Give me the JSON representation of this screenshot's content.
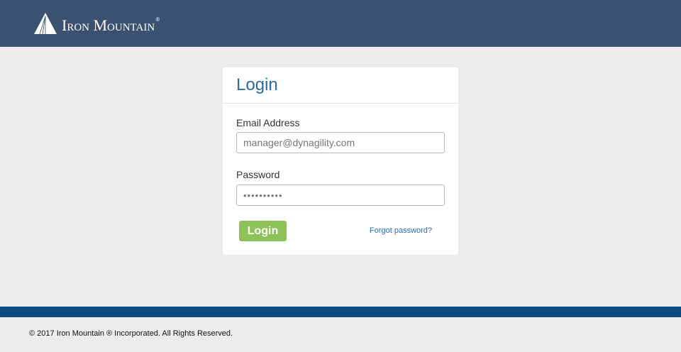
{
  "header": {
    "brand": "Iron Mountain",
    "logo_icon": "mountain-logo-icon",
    "colors": {
      "background": "#3a5170",
      "logo": "#ffffff"
    }
  },
  "login_card": {
    "title": "Login",
    "email": {
      "label": "Email Address",
      "placeholder": "manager@dynagility.com",
      "value": ""
    },
    "password": {
      "label": "Password",
      "value_masked": "••••••••••"
    },
    "login_button": "Login",
    "forgot_link": "Forgot password?",
    "colors": {
      "title": "#2a6aa8",
      "button": "#8dc258",
      "link": "#2a6aa8"
    }
  },
  "footer": {
    "copyright": "© 2017 Iron Mountain ® Incorporated. All Rights Reserved.",
    "colors": {
      "bar": "#0d4a82"
    }
  }
}
